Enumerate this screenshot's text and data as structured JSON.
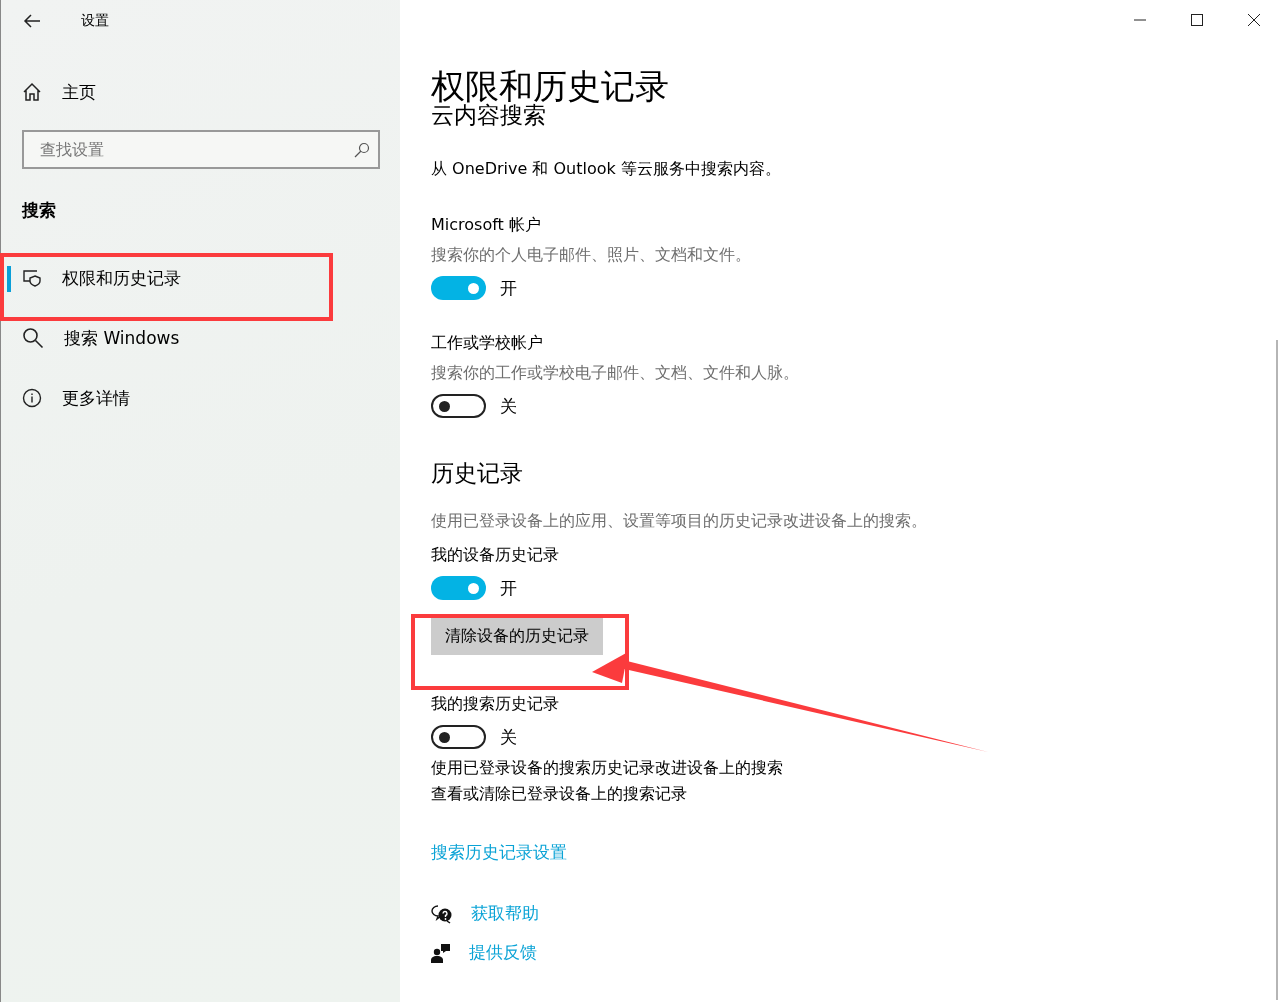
{
  "window": {
    "title": "设置"
  },
  "sidebar": {
    "home": "主页",
    "search": {
      "placeholder": "查找设置"
    },
    "section": "搜索",
    "items": [
      {
        "label": "权限和历史记录",
        "selected": true
      },
      {
        "label": "搜索 Windows",
        "selected": false
      },
      {
        "label": "更多详情",
        "selected": false
      }
    ]
  },
  "page": {
    "title": "权限和历史记录",
    "blocks": [
      {
        "kind": "subheading",
        "text": "云内容搜索"
      },
      {
        "kind": "paragraph",
        "text": "从 OneDrive 和 Outlook 等云服务中搜索内容。"
      },
      {
        "kind": "setting",
        "label": "Microsoft 帐户",
        "description": "搜索你的个人电子邮件、照片、文档和文件。",
        "on": true,
        "state": "开"
      },
      {
        "kind": "setting",
        "label": "工作或学校帐户",
        "description": "搜索你的工作或学校电子邮件、文档、文件和人脉。",
        "on": false,
        "state": "关"
      },
      {
        "kind": "heading",
        "text": "历史记录"
      },
      {
        "kind": "note",
        "text": "使用已登录设备上的应用、设置等项目的历史记录改进设备上的搜索。"
      },
      {
        "kind": "setting",
        "label": "我的设备历史记录",
        "on": true,
        "state": "开"
      },
      {
        "kind": "button",
        "text": "清除设备的历史记录"
      },
      {
        "kind": "setting",
        "label": "我的搜索历史记录",
        "on": false,
        "state": "关"
      },
      {
        "kind": "paragraph",
        "text": "使用已登录设备的搜索历史记录改进设备上的搜索"
      },
      {
        "kind": "paragraph",
        "text": "查看或清除已登录设备上的搜索记录"
      },
      {
        "kind": "link",
        "text": "搜索历史记录设置"
      }
    ],
    "help": [
      {
        "label": "获取帮助"
      },
      {
        "label": "提供反馈"
      }
    ]
  }
}
